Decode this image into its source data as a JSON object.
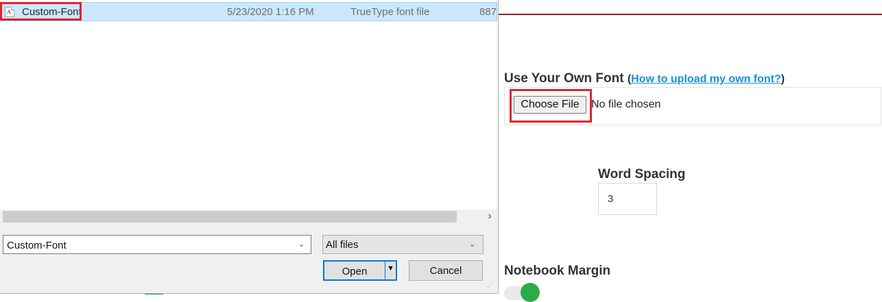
{
  "file_dialog": {
    "file_row": {
      "name": "Custom-Font",
      "date_modified": "5/23/2020 1:16 PM",
      "type": "TrueType font file",
      "size": "887"
    },
    "file_name_value": "Custom-Font",
    "file_type_filter": "All files",
    "open_label": "Open",
    "cancel_label": "Cancel",
    "icons": [
      "font-file-icon",
      "scroll-right-arrow-icon",
      "chevron-down-icon",
      "split-dropdown-icon",
      "resize-grip-icon"
    ]
  },
  "webpage": {
    "font_section": {
      "title": "Use Your Own Font",
      "paren_open": "(",
      "help_link": "How to upload my own font?",
      "paren_close": ")"
    },
    "choose_file_label": "Choose File",
    "no_file_text": "No file chosen",
    "word_spacing": {
      "label": "Word Spacing",
      "value": "3"
    },
    "notebook_margin": {
      "label": "Notebook Margin",
      "toggle_on": true
    }
  },
  "colors": {
    "highlight": "#e3222b",
    "selection": "#cce8ff",
    "link": "#1a8ee0",
    "toggle": "#2daa4a",
    "rule": "#a01a20"
  }
}
